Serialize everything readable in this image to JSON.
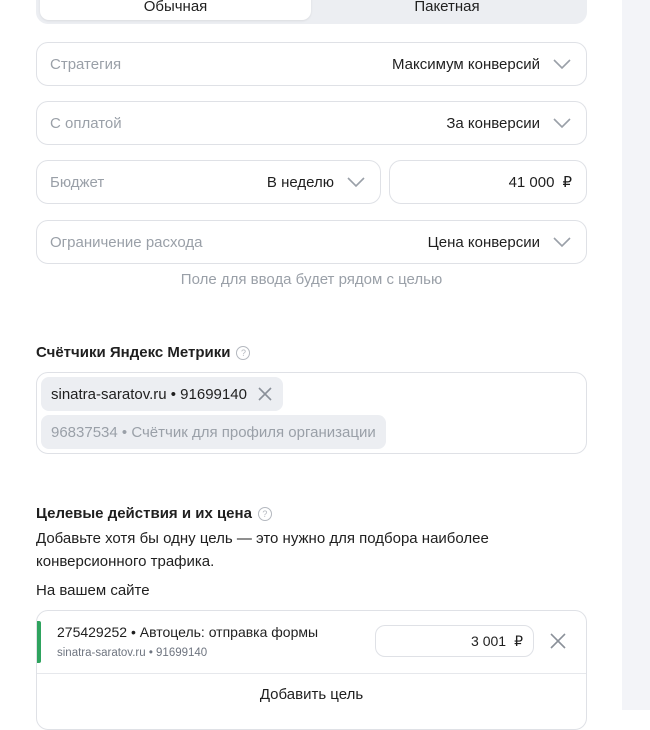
{
  "tabs": {
    "regular_label": "Обычная",
    "package_label": "Пакетная",
    "active": "regular"
  },
  "strategy": {
    "label": "Стратегия",
    "value": "Максимум конверсий"
  },
  "payment": {
    "label": "С оплатой",
    "value": "За конверсии"
  },
  "budget": {
    "label": "Бюджет",
    "period": "В неделю",
    "amount": "41 000",
    "currency": "₽"
  },
  "spend_limit": {
    "label": "Ограничение расхода",
    "value": "Цена конверсии"
  },
  "hint": "Поле для ввода будет рядом с целью",
  "metrika": {
    "title": "Счётчики Яндекс Метрики",
    "help_glyph": "?",
    "selected_counter": "sinatra-saratov.ru • 91699140",
    "suggested_counter": "96837534 • Счётчик для профиля организации"
  },
  "goals": {
    "title": "Целевые действия и их цена",
    "help_glyph": "?",
    "description": "Добавьте хотя бы одну цель — это нужно для подбора наиболее конверсионного трафика.",
    "on_site_label": "На вашем сайте",
    "items": [
      {
        "title": "275429252 • Автоцель: отправка формы",
        "subtitle": "sinatra-saratov.ru • 91699140",
        "price": "3 001",
        "currency": "₽",
        "accent_color": "#2ea35e"
      }
    ],
    "add_button": "Добавить цель"
  },
  "icons": {
    "chevron": "chevron-down-icon",
    "close": "close-icon",
    "help": "question-circle-icon"
  }
}
